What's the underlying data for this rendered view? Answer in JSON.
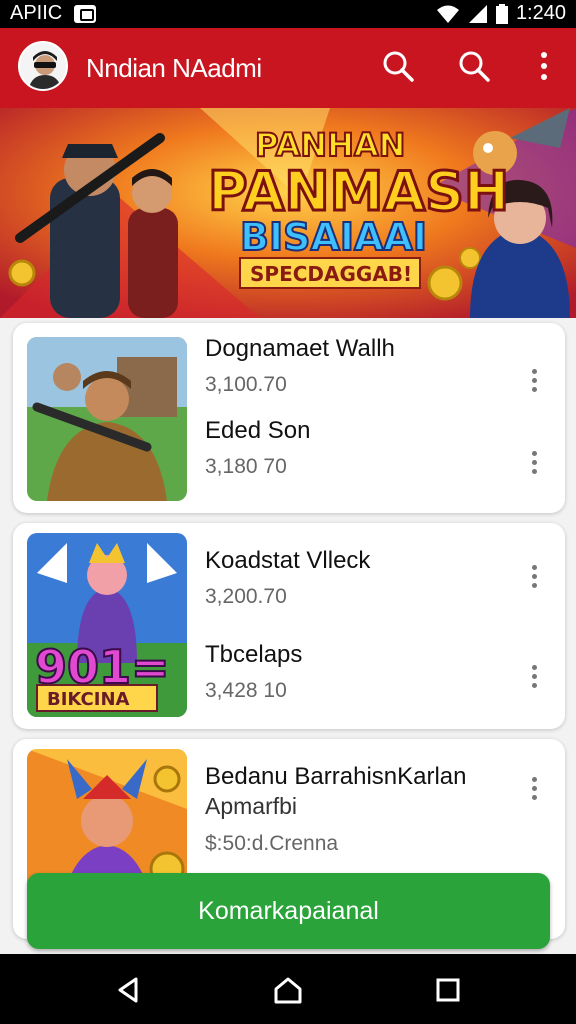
{
  "status_bar": {
    "carrier": "APIIC",
    "time": "1:240"
  },
  "app_bar": {
    "title": "Nndian NAadmi"
  },
  "banner": {
    "line1": "PANHAN",
    "line2": "PANMASH",
    "line3": "BISAIAAI",
    "line4": "SPECDAGGAB!"
  },
  "cards": [
    {
      "entries": [
        {
          "name": "Dognamaet Wallh",
          "value": "3,100.70"
        },
        {
          "name": "Eded Son",
          "value": "3,180 70"
        }
      ]
    },
    {
      "thumb_text": {
        "number": "901=",
        "label": "BIKCINA"
      },
      "entries": [
        {
          "name": "Koadstat Vlleck",
          "value": "3,200.70"
        },
        {
          "name": "Tbcelaps",
          "value": "3,428 10"
        }
      ]
    },
    {
      "entries": [
        {
          "name": "Bedanu BarrahisnKarlan",
          "value": "Apmarfbi"
        },
        {
          "name": "$:50:d.Crenna"
        }
      ]
    }
  ],
  "action_button": {
    "label": "Komarkapaianal"
  },
  "colors": {
    "app_bar": "#c9151f",
    "action": "#2aa33a",
    "status_bar": "#000000"
  },
  "icons": [
    "search-icon",
    "search-icon",
    "more-vert-icon",
    "back-icon",
    "home-icon",
    "recents-icon",
    "wifi-icon",
    "signal-icon"
  ]
}
